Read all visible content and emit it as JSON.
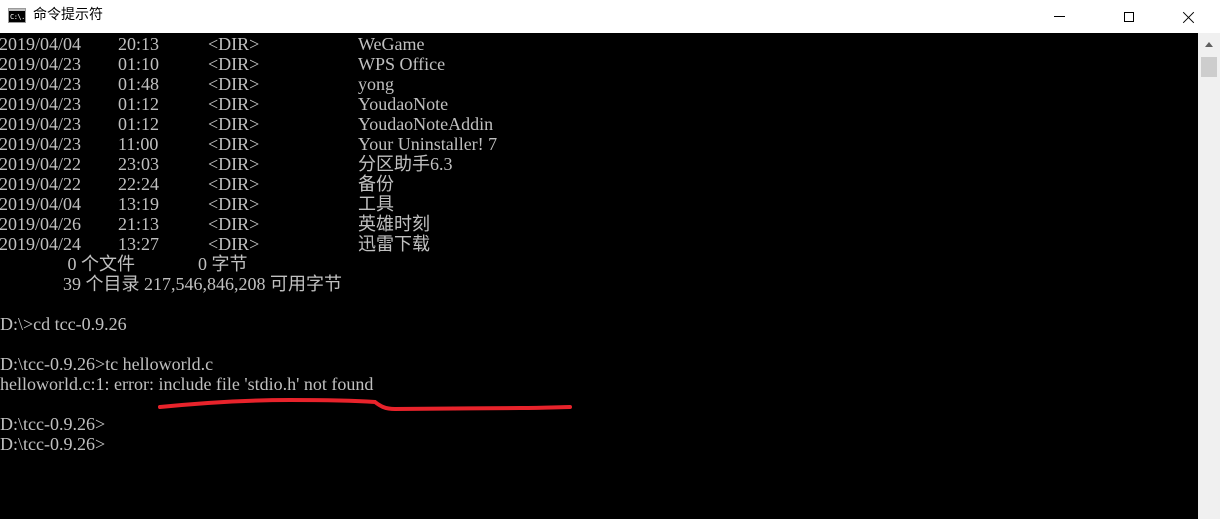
{
  "window": {
    "title": "命令提示符",
    "icon_text": "C:\\."
  },
  "console": {
    "dir_rows": [
      {
        "date": "2019/04/04",
        "time": "20:13",
        "type": "<DIR>",
        "name": "WeGame"
      },
      {
        "date": "2019/04/23",
        "time": "01:10",
        "type": "<DIR>",
        "name": "WPS Office"
      },
      {
        "date": "2019/04/23",
        "time": "01:48",
        "type": "<DIR>",
        "name": "yong"
      },
      {
        "date": "2019/04/23",
        "time": "01:12",
        "type": "<DIR>",
        "name": "YoudaoNote"
      },
      {
        "date": "2019/04/23",
        "time": "01:12",
        "type": "<DIR>",
        "name": "YoudaoNoteAddin"
      },
      {
        "date": "2019/04/23",
        "time": "11:00",
        "type": "<DIR>",
        "name": "Your Uninstaller! 7"
      },
      {
        "date": "2019/04/22",
        "time": "23:03",
        "type": "<DIR>",
        "name": "分区助手6.3"
      },
      {
        "date": "2019/04/22",
        "time": "22:24",
        "type": "<DIR>",
        "name": "备份"
      },
      {
        "date": "2019/04/04",
        "time": "13:19",
        "type": "<DIR>",
        "name": "工具"
      },
      {
        "date": "2019/04/26",
        "time": "21:13",
        "type": "<DIR>",
        "name": "英雄时刻"
      },
      {
        "date": "2019/04/24",
        "time": "13:27",
        "type": "<DIR>",
        "name": "迅雷下载"
      }
    ],
    "summary_files": "               0 个文件              0 字节",
    "summary_dirs": "              39 个目录 217,546,846,208 可用字节",
    "cmd_cd": "D:\\>cd tcc-0.9.26",
    "cmd_tc": "D:\\tcc-0.9.26>tc helloworld.c",
    "error_line": "helloworld.c:1: error: include file 'stdio.h' not found",
    "prompt_1": "D:\\tcc-0.9.26>",
    "prompt_2": "D:\\tcc-0.9.26>"
  },
  "colors": {
    "console_bg": "#000000",
    "console_text": "#c0c0c0",
    "annotation": "#e8232b"
  }
}
